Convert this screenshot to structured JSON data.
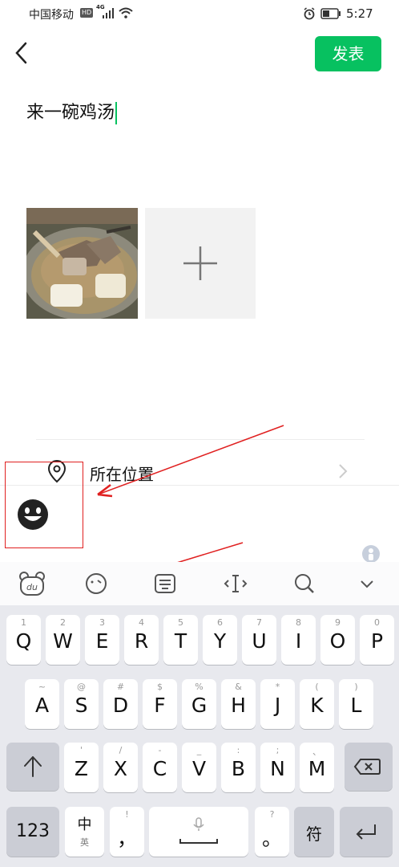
{
  "status_bar": {
    "carrier": "中国移动",
    "hd_badge": "HD",
    "network": "4G",
    "time": "5:27"
  },
  "header": {
    "publish_label": "发表"
  },
  "post": {
    "text": "来一碗鸡汤"
  },
  "location": {
    "label": "所在位置"
  },
  "keyboard": {
    "row1": [
      {
        "main": "Q",
        "sub": "1"
      },
      {
        "main": "W",
        "sub": "2"
      },
      {
        "main": "E",
        "sub": "3"
      },
      {
        "main": "R",
        "sub": "4"
      },
      {
        "main": "T",
        "sub": "5"
      },
      {
        "main": "Y",
        "sub": "6"
      },
      {
        "main": "U",
        "sub": "7"
      },
      {
        "main": "I",
        "sub": "8"
      },
      {
        "main": "O",
        "sub": "9"
      },
      {
        "main": "P",
        "sub": "0"
      }
    ],
    "row2": [
      {
        "main": "A",
        "sub": "~"
      },
      {
        "main": "S",
        "sub": "@"
      },
      {
        "main": "D",
        "sub": "#"
      },
      {
        "main": "F",
        "sub": "$"
      },
      {
        "main": "G",
        "sub": "%"
      },
      {
        "main": "H",
        "sub": "&"
      },
      {
        "main": "J",
        "sub": "*"
      },
      {
        "main": "K",
        "sub": "("
      },
      {
        "main": "L",
        "sub": ")"
      }
    ],
    "row3": [
      {
        "main": "Z",
        "sub": "'"
      },
      {
        "main": "X",
        "sub": "/"
      },
      {
        "main": "C",
        "sub": "-"
      },
      {
        "main": "V",
        "sub": "_"
      },
      {
        "main": "B",
        "sub": ":"
      },
      {
        "main": "N",
        "sub": ";"
      },
      {
        "main": "M",
        "sub": "、"
      }
    ],
    "num_key": "123",
    "lang_key_main": "中",
    "lang_key_sub": "英",
    "comma_main": "，",
    "comma_sub": "!",
    "period_main": "。",
    "period_sub": "?",
    "symbol_key": "符"
  },
  "colors": {
    "accent": "#07c160",
    "annotation": "#e02020",
    "keyboard_bg": "#e8e9ee"
  }
}
